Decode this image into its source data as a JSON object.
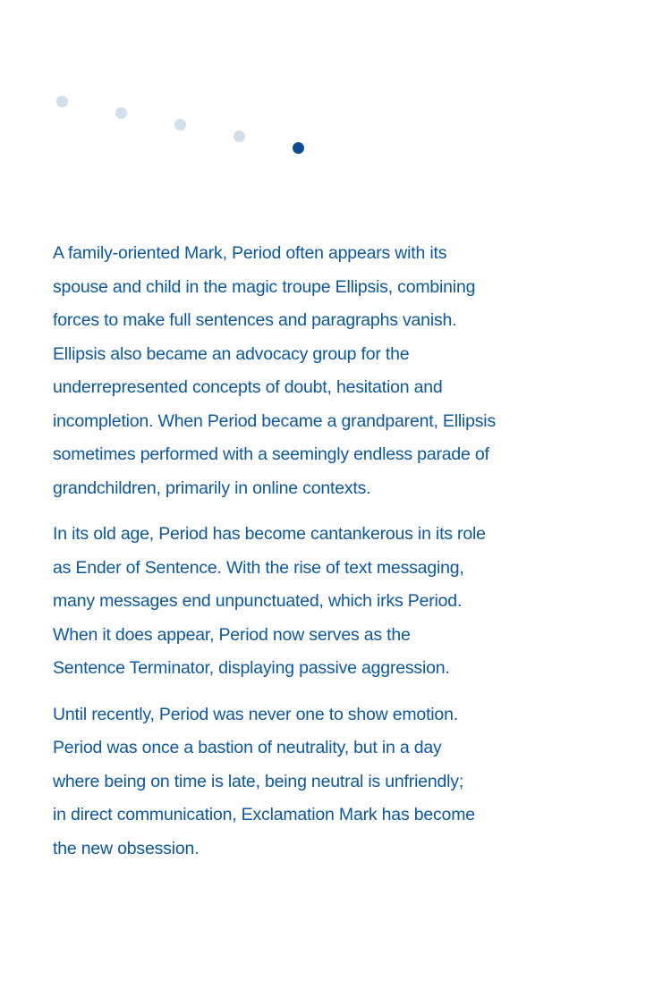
{
  "colors": {
    "text": "#0b57a0",
    "dot_light": "#cfdfec",
    "dot_active": "#0b4f92"
  },
  "pager": {
    "dots": [
      {
        "state": "inactive"
      },
      {
        "state": "inactive"
      },
      {
        "state": "inactive"
      },
      {
        "state": "inactive"
      },
      {
        "state": "active"
      }
    ]
  },
  "article": {
    "paragraphs": [
      "A family-oriented Mark, Period often appears with its\nspouse and child in the magic troupe Ellipsis, combining\nforces to make full sentences and paragraphs vanish.\nEllipsis also became an advocacy group for the\nunderrepresented concepts of doubt, hesitation and\nincompletion. When Period became a grandparent, Ellipsis\nsometimes performed with a seemingly endless parade of\ngrandchildren, primarily in online contexts.",
      "In its old age, Period has become cantankerous in its role\nas Ender of Sentence. With the rise of text messaging,\nmany messages end unpunctuated, which irks Period.\nWhen it does appear, Period now serves as the\nSentence Terminator, displaying passive aggression.",
      "Until recently, Period was never one to show emotion.\nPeriod was once a bastion of neutrality, but in a day\nwhere being on time is late, being neutral is unfriendly;\nin direct communication, Exclamation Mark has become\nthe new obsession."
    ]
  }
}
